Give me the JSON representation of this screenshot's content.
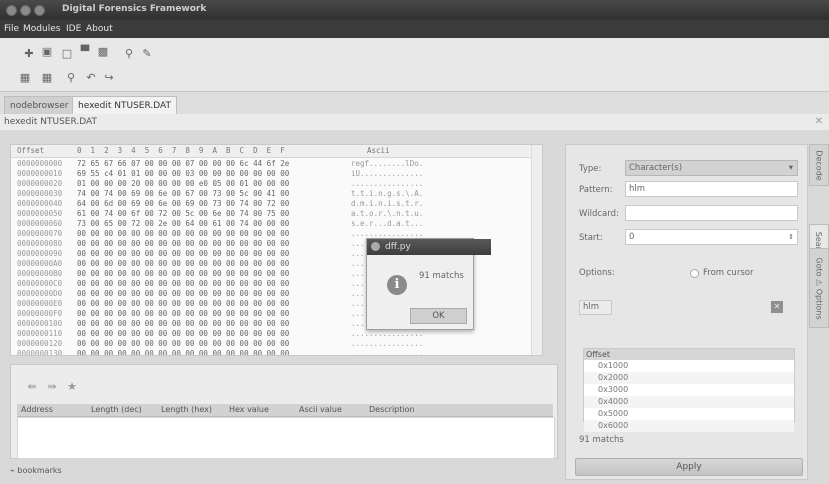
{
  "window": {
    "title": "Digital Forensics Framework"
  },
  "menu": {
    "file": "File",
    "modules": "Modules",
    "ide": "IDE",
    "about": "About"
  },
  "tabs": {
    "nodebrowser": "nodebrowser",
    "hexedit": "hexedit NTUSER.DAT"
  },
  "content_title": "hexedit NTUSER.DAT",
  "hex": {
    "header_offset": "Offset",
    "header_bytes": "0  1  2  3  4  5  6  7  8  9  A  B  C  D  E  F",
    "header_ascii": "Ascii",
    "rows": [
      {
        "off": "0000000000",
        "bytes": "72 65 67 66 07 00 00 00 07 00 00 00 6c 44 6f 2e",
        "ascii": "regf........lDo."
      },
      {
        "off": "0000000010",
        "bytes": "69 55 c4 01 01 00 00 00 03 00 00 00 00 00 00 00",
        "ascii": "iU.............."
      },
      {
        "off": "0000000020",
        "bytes": "01 00 00 00 20 00 00 00 00 e0 05 00 01 00 00 00",
        "ascii": "................"
      },
      {
        "off": "0000000030",
        "bytes": "74 00 74 00 69 00 6e 00 67 00 73 00 5c 00 41 00",
        "ascii": "t.t.i.n.g.s.\\.A."
      },
      {
        "off": "0000000040",
        "bytes": "64 00 6d 00 69 00 6e 00 69 00 73 00 74 00 72 00",
        "ascii": "d.m.i.n.i.s.t.r."
      },
      {
        "off": "0000000050",
        "bytes": "61 00 74 00 6f 00 72 00 5c 00 6e 00 74 00 75 00",
        "ascii": "a.t.o.r.\\.n.t.u."
      },
      {
        "off": "0000000060",
        "bytes": "73 00 65 00 72 00 2e 00 64 00 61 00 74 00 00 00",
        "ascii": "s.e.r...d.a.t..."
      },
      {
        "off": "0000000070",
        "bytes": "00 00 00 00 00 00 00 00 00 00 00 00 00 00 00 00",
        "ascii": "................"
      },
      {
        "off": "0000000080",
        "bytes": "00 00 00 00 00 00 00 00 00 00 00 00 00 00 00 00",
        "ascii": "................"
      },
      {
        "off": "0000000090",
        "bytes": "00 00 00 00 00 00 00 00 00 00 00 00 00 00 00 00",
        "ascii": "................"
      },
      {
        "off": "00000000A0",
        "bytes": "00 00 00 00 00 00 00 00 00 00 00 00 00 00 00 00",
        "ascii": "................"
      },
      {
        "off": "00000000B0",
        "bytes": "00 00 00 00 00 00 00 00 00 00 00 00 00 00 00 00",
        "ascii": "................"
      },
      {
        "off": "00000000C0",
        "bytes": "00 00 00 00 00 00 00 00 00 00 00 00 00 00 00 00",
        "ascii": "................"
      },
      {
        "off": "00000000D0",
        "bytes": "00 00 00 00 00 00 00 00 00 00 00 00 00 00 00 00",
        "ascii": "................"
      },
      {
        "off": "00000000E0",
        "bytes": "00 00 00 00 00 00 00 00 00 00 00 00 00 00 00 00",
        "ascii": "................"
      },
      {
        "off": "00000000F0",
        "bytes": "00 00 00 00 00 00 00 00 00 00 00 00 00 00 00 00",
        "ascii": "................"
      },
      {
        "off": "0000000100",
        "bytes": "00 00 00 00 00 00 00 00 00 00 00 00 00 00 00 00",
        "ascii": "................"
      },
      {
        "off": "0000000110",
        "bytes": "00 00 00 00 00 00 00 00 00 00 00 00 00 00 00 00",
        "ascii": "................"
      },
      {
        "off": "0000000120",
        "bytes": "00 00 00 00 00 00 00 00 00 00 00 00 00 00 00 00",
        "ascii": "................"
      },
      {
        "off": "0000000130",
        "bytes": "00 00 00 00 00 00 00 00 00 00 00 00 00 00 00 00",
        "ascii": "................"
      }
    ]
  },
  "bookmarks": {
    "columns": [
      "Address",
      "Length (dec)",
      "Length (hex)",
      "Hex value",
      "Ascii value",
      "Description"
    ],
    "tab_label": "bookmarks"
  },
  "search": {
    "type_label": "Type:",
    "type_value": "Character(s)",
    "pattern_label": "Pattern:",
    "pattern_value": "hlm",
    "wildcard_label": "Wildcard:",
    "wildcard_value": "",
    "start_label": "Start:",
    "start_value": "0",
    "options_label": "Options:",
    "from_cursor_label": "From cursor",
    "result_pattern": "hlm",
    "offset_header": "Offset",
    "offsets": [
      "0x1000",
      "0x2000",
      "0x3000",
      "0x4000",
      "0x5000",
      "0x6000"
    ],
    "matches_label": "91 matchs",
    "apply_label": "Apply"
  },
  "side_tabs": {
    "decode": "Decode",
    "search": "Search",
    "goto": "Goto",
    "options": "Options"
  },
  "dialog": {
    "title": "dff.py",
    "message": "91 matchs",
    "ok": "OK"
  }
}
